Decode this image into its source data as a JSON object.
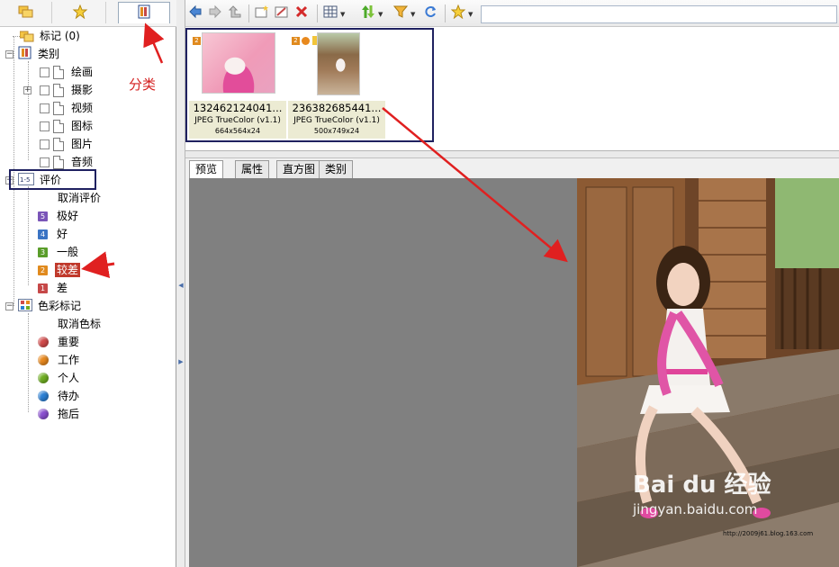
{
  "left_tabs": [
    {
      "icon": "folders-icon"
    },
    {
      "icon": "star-icon"
    },
    {
      "icon": "category-book-icon"
    }
  ],
  "tree": {
    "root_label": "标记 (0)",
    "categories": {
      "label": "类别",
      "items": [
        "绘画",
        "摄影",
        "视频",
        "图标",
        "图片",
        "音频"
      ]
    },
    "rating": {
      "label": "评价",
      "clear": "取消评价",
      "items": [
        {
          "badge": "5",
          "label": "极好",
          "color": "#7a55b8"
        },
        {
          "badge": "4",
          "label": "好",
          "color": "#3b74c4"
        },
        {
          "badge": "3",
          "label": "一般",
          "color": "#5a9d2a"
        },
        {
          "badge": "2",
          "label": "较差",
          "color": "#e08a1e",
          "selected": true
        },
        {
          "badge": "1",
          "label": "差",
          "color": "#c64848"
        }
      ]
    },
    "color_labels": {
      "label": "色彩标记",
      "clear": "取消色标",
      "items": [
        {
          "label": "重要",
          "color": "#d14a4a"
        },
        {
          "label": "工作",
          "color": "#e8891e"
        },
        {
          "label": "个人",
          "color": "#6fae22"
        },
        {
          "label": "待办",
          "color": "#2a7fd4"
        },
        {
          "label": "拖后",
          "color": "#8a4fd0"
        }
      ]
    }
  },
  "toolbar": {
    "search_value": "",
    "icons": [
      "back-arrow-icon",
      "forward-arrow-icon",
      "up-folder-icon",
      "new-folder-icon",
      "rename-icon",
      "delete-icon",
      "view-mode-icon",
      "sort-icon",
      "filter-icon",
      "refresh-icon",
      "rating-star-icon"
    ]
  },
  "thumbnails": [
    {
      "name": "132462124041...",
      "format": "JPEG TrueColor (v1.1)",
      "dimensions": "664x564x24",
      "badge": "2"
    },
    {
      "name": "236382685441...",
      "format": "JPEG TrueColor (v1.1)",
      "dimensions": "500x749x24",
      "badge": "2"
    }
  ],
  "preview_tabs": [
    "预览",
    "属性",
    "直方图",
    "类别"
  ],
  "watermark": {
    "brand": "Bai du 经验",
    "url": "jingyan.baidu.com",
    "small": "http://2009j61.blog.163.com"
  },
  "annotations": {
    "category_note": "分类"
  },
  "colors": {
    "annotation_red": "#e02020",
    "annotation_box": "#1f2160",
    "selection_red": "#c0392b"
  }
}
